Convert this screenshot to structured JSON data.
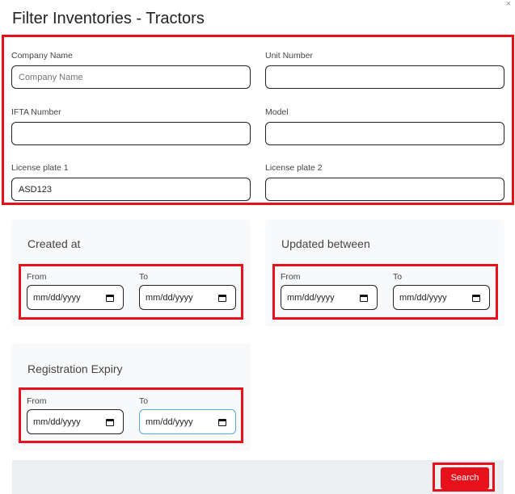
{
  "dialog": {
    "title": "Filter Inventories - Tractors",
    "close_glyph": "×"
  },
  "fields": {
    "company_name": {
      "label": "Company Name",
      "value": "",
      "placeholder": "Company Name"
    },
    "unit_number": {
      "label": "Unit Number",
      "value": ""
    },
    "ifta_number": {
      "label": "IFTA Number",
      "value": ""
    },
    "model": {
      "label": "Model",
      "value": ""
    },
    "license_plate_1": {
      "label": "License plate 1",
      "value": "ASD123"
    },
    "license_plate_2": {
      "label": "License plate 2",
      "value": ""
    }
  },
  "created_at": {
    "title": "Created at",
    "from_label": "From",
    "to_label": "To",
    "from_value": "mm/dd/yyyy",
    "to_value": "mm/dd/yyyy"
  },
  "updated_between": {
    "title": "Updated between",
    "from_label": "From",
    "to_label": "To",
    "from_value": "mm/dd/yyyy",
    "to_value": "mm/dd/yyyy"
  },
  "registration_expiry": {
    "title": "Registration Expiry",
    "from_label": "From",
    "to_label": "To",
    "from_value": "mm/dd/yyyy",
    "to_value": "mm/dd/yyyy"
  },
  "footer": {
    "search_label": "Search"
  },
  "colors": {
    "highlight": "#e8101b",
    "primary_button": "#e8101b",
    "card_bg": "#f8f9fa",
    "footer_bg": "#eceff2"
  },
  "icons": {
    "date_picker": "calendar-icon",
    "close": "close-icon"
  }
}
